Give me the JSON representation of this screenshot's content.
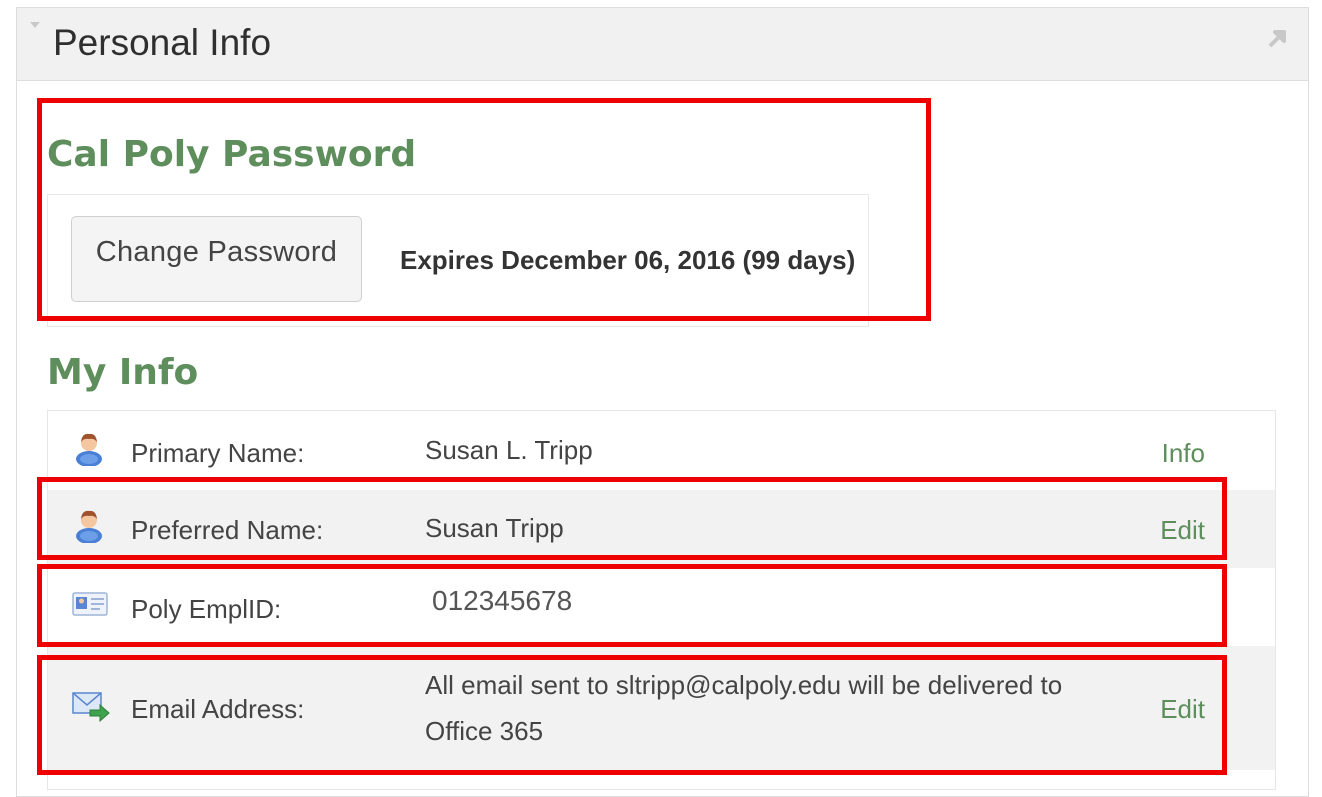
{
  "panel": {
    "title": "Personal Info"
  },
  "password": {
    "heading": "Cal Poly Password",
    "change_button": "Change Password",
    "expires_text": "Expires December 06, 2016 (99 days)"
  },
  "my_info": {
    "heading": "My Info",
    "rows": [
      {
        "icon": "person-icon",
        "label": "Primary Name:",
        "value": "Susan L. Tripp",
        "link": "Info"
      },
      {
        "icon": "person-icon",
        "label": "Preferred Name:",
        "value": "Susan Tripp",
        "link": "Edit"
      },
      {
        "icon": "id-card-icon",
        "label": "Poly EmplID:",
        "value": "012345678",
        "link": ""
      },
      {
        "icon": "email-forward-icon",
        "label": "Email Address:",
        "value_line1": "All email sent to sltripp@calpoly.edu will be delivered to",
        "value_line2": "Office 365",
        "link": "Edit"
      }
    ]
  },
  "colors": {
    "accent_green": "#5d8e5b",
    "highlight_red": "#ee0000",
    "row_alt": "#f2f2f2"
  }
}
